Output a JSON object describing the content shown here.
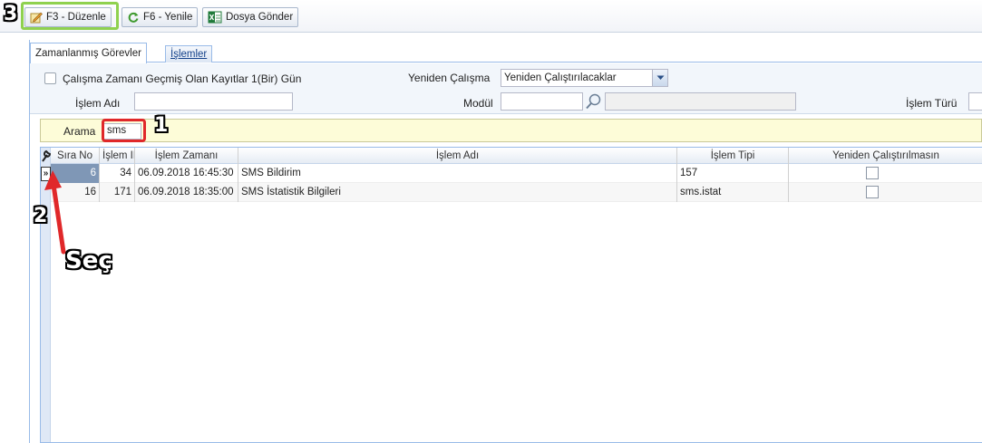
{
  "toolbar": {
    "edit_label": "F3 - Düzenle",
    "refresh_label": "F6 - Yenile",
    "send_label": "Dosya Gönder"
  },
  "tabs": [
    {
      "label": "Zamanlanmış Görevler",
      "active": true
    },
    {
      "label": "İşlemler",
      "active": false
    }
  ],
  "filters": {
    "past_records_label": "Çalışma Zamanı Geçmiş Olan Kayıtlar 1(Bir) Gün",
    "rerun_label": "Yeniden Çalışma",
    "rerun_value": "Yeniden Çalıştırılacaklar",
    "name_label": "İşlem Adı",
    "module_label": "Modül",
    "type_label": "İşlem Türü"
  },
  "search": {
    "label": "Arama",
    "value": "sms"
  },
  "grid": {
    "columns": [
      "Sıra No",
      "İşlem ID",
      "İşlem Zamanı",
      "İşlem Adı",
      "İşlem Tipi",
      "Yeniden Çalıştırılmasın"
    ],
    "rows": [
      {
        "seq": "6",
        "id": "34",
        "time": "06.09.2018 16:45:30",
        "name": "SMS Bildirim",
        "type": "157",
        "selected": true
      },
      {
        "seq": "16",
        "id": "171",
        "time": "06.09.2018 18:35:00",
        "name": "SMS İstatistik Bilgileri",
        "type": "sms.istat",
        "selected": false
      }
    ]
  },
  "annotations": {
    "step1": "1",
    "step2": "2",
    "step3": "3",
    "select_text": "Seç",
    "select_marker": "»"
  },
  "colors": {
    "highlight_green": "#8fd14f",
    "highlight_red": "#e0282a",
    "arrow_red": "#e0282a"
  }
}
